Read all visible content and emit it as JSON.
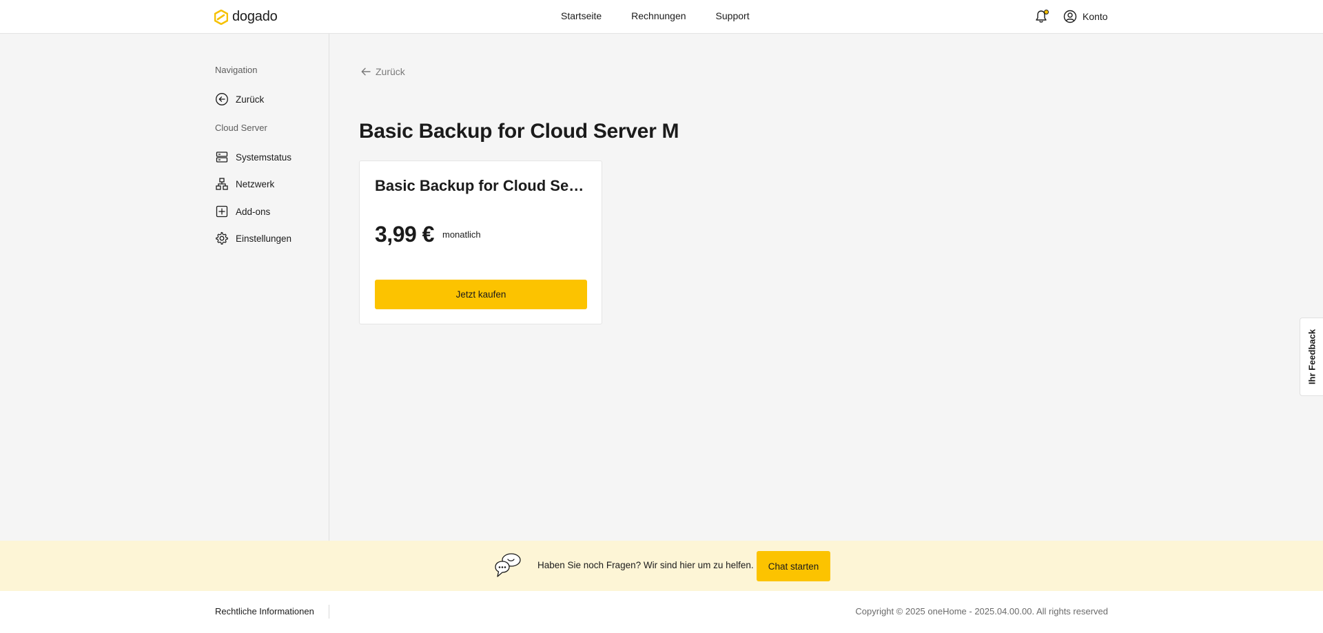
{
  "brand": {
    "name": "dogado",
    "accent": "#fcc300"
  },
  "topnav": {
    "items": [
      "Startseite",
      "Rechnungen",
      "Support"
    ]
  },
  "account": {
    "label": "Konto"
  },
  "sidebar": {
    "heading_nav": "Navigation",
    "back_label": "Zurück",
    "heading_section": "Cloud Server",
    "items": [
      {
        "label": "Systemstatus",
        "icon": "server-icon"
      },
      {
        "label": "Netzwerk",
        "icon": "network-icon"
      },
      {
        "label": "Add-ons",
        "icon": "plus-square-icon"
      },
      {
        "label": "Einstellungen",
        "icon": "gear-icon"
      }
    ]
  },
  "main": {
    "back_label": "Zurück",
    "title": "Basic Backup for Cloud Server M",
    "card": {
      "title": "Basic Backup for Cloud Server M",
      "price": "3,99 €",
      "period": "monatlich",
      "buy_label": "Jetzt kaufen"
    }
  },
  "feedback": {
    "label": "Ihr Feedback"
  },
  "helpbar": {
    "text": "Haben Sie noch Fragen? Wir sind hier um zu helfen.",
    "button_label": "Chat starten"
  },
  "footer": {
    "legal": "Rechtliche Informationen",
    "copyright": "Copyright © 2025 oneHome - 2025.04.00.00. All rights reserved"
  }
}
